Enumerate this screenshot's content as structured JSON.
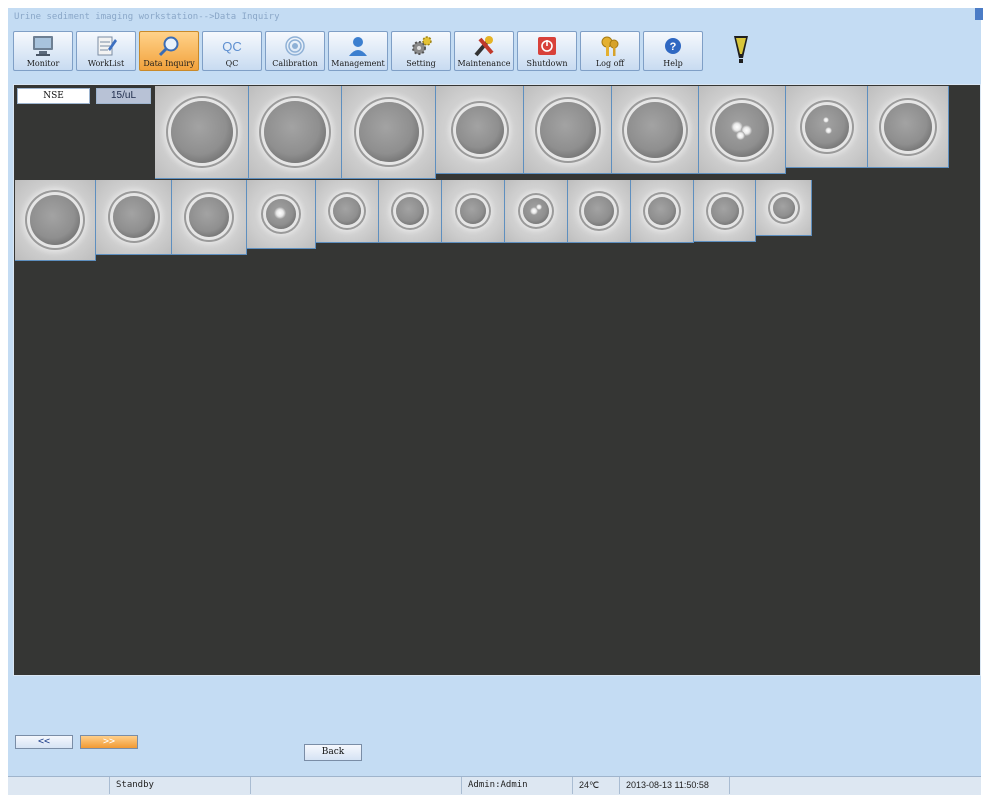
{
  "window": {
    "title": "Urine sediment imaging workstation-->Data Inquiry"
  },
  "toolbar": {
    "buttons": [
      {
        "label": "Monitor",
        "icon": "monitor-icon"
      },
      {
        "label": "WorkList",
        "icon": "worklist-icon"
      },
      {
        "label": "Data Inquiry",
        "icon": "magnifier-icon",
        "active": true
      },
      {
        "label": "QC",
        "icon": "qc-icon"
      },
      {
        "label": "Calibration",
        "icon": "target-icon"
      },
      {
        "label": "Management",
        "icon": "user-icon"
      },
      {
        "label": "Setting",
        "icon": "gears-icon"
      },
      {
        "label": "Maintenance",
        "icon": "tools-icon"
      },
      {
        "label": "Shutdown",
        "icon": "power-icon"
      },
      {
        "label": "Log off",
        "icon": "keys-icon"
      },
      {
        "label": "Help",
        "icon": "help-icon"
      }
    ],
    "qc_icon_text": "QC"
  },
  "viewer": {
    "class_label": "NSE",
    "count_label": "15/uL",
    "thumbnail_count": 21
  },
  "pager": {
    "prev_label": "<<",
    "next_label": ">>"
  },
  "back_label": "Back",
  "status_bar": {
    "blank1": "",
    "state": "Standby",
    "blank2": "",
    "user": "Admin:Admin",
    "temperature": "24℃",
    "datetime": "2013-08-13 11:50:58"
  },
  "colors": {
    "accent_active": "#f2a23c",
    "panel_bg": "#353634",
    "chrome_bg": "#c4dcf3"
  }
}
